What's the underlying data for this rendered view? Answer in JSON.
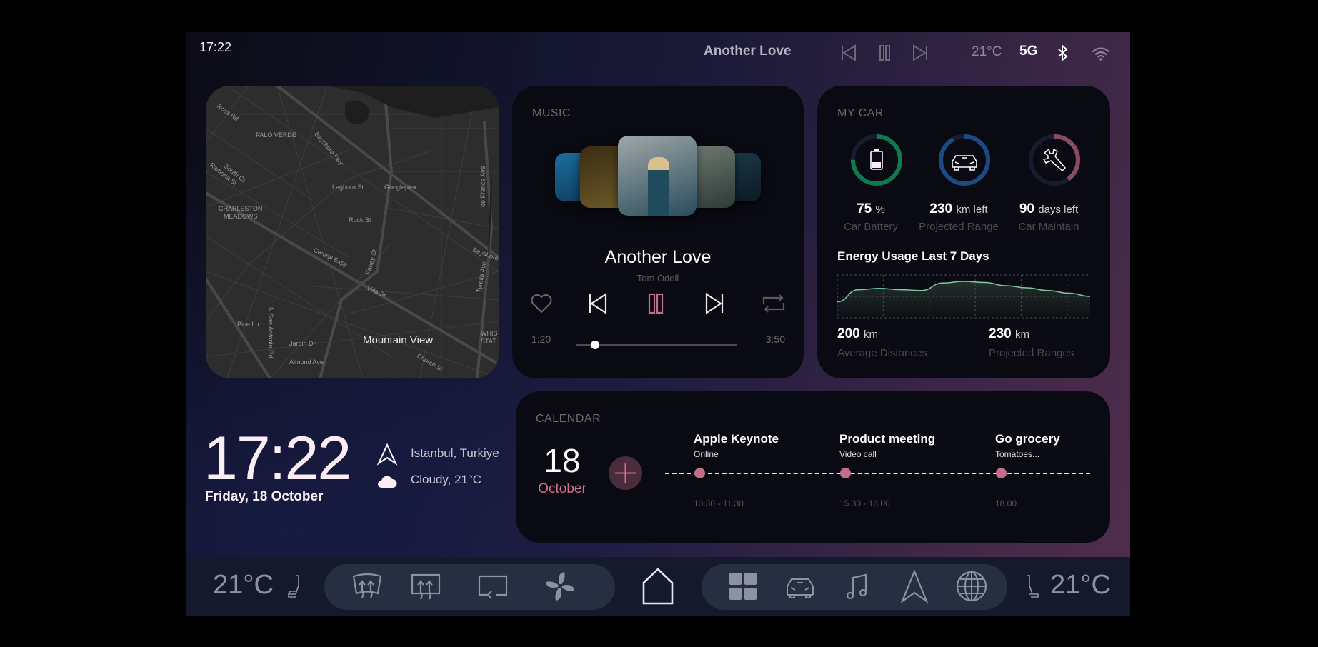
{
  "status_bar": {
    "time": "17:22",
    "now_playing": "Another Love",
    "temperature": "21°C",
    "network": "5G",
    "icons": [
      "previous-icon",
      "pause-icon",
      "next-icon",
      "bluetooth-icon",
      "wifi-icon"
    ]
  },
  "map": {
    "city_label": "Mountain View",
    "labels": [
      "Ross Rd",
      "PALO VERDE",
      "Bayshore Fwy",
      "South Ct",
      "Ramona St",
      "Leghorn St",
      "Googleplex",
      "CHARLESTON",
      "MEADOWS",
      "Rock St",
      "Central Expy",
      "Farley St",
      "Villa St",
      "de France Ave",
      "Bayshore",
      "Tyrella Ave",
      "Pine Ln",
      "N San Antonio Rd",
      "Jardin Dr",
      "Almond Ave",
      "Church St",
      "WHIS",
      "STAT"
    ]
  },
  "music": {
    "section_title": "MUSIC",
    "song_title": "Another Love",
    "artist": "Tom Odell",
    "elapsed": "1:20",
    "duration": "3:50",
    "progress_fraction": 0.12,
    "covers": [
      {
        "name": "nirvana-cover",
        "colors": [
          "#1c6fa0",
          "#0d3a5c"
        ]
      },
      {
        "name": "bmth-cover",
        "colors": [
          "#3a2c12",
          "#6e5a2a"
        ]
      },
      {
        "name": "tom-odell-cover",
        "colors": [
          "#9fa7a8",
          "#2a4d5c"
        ]
      },
      {
        "name": "caleo-cover",
        "colors": [
          "#6f7a72",
          "#2e3a36"
        ]
      },
      {
        "name": "imagine-dragons-cover",
        "colors": [
          "#1a3a4a",
          "#0c1a24"
        ]
      }
    ]
  },
  "car": {
    "section_title": "MY CAR",
    "gauges": [
      {
        "value": "75",
        "unit": "%",
        "label": "Car Battery",
        "fraction": 0.75,
        "color": "#0f7a52",
        "icon": "battery-icon"
      },
      {
        "value": "230",
        "unit": "km left",
        "label": "Projected Range",
        "fraction": 0.92,
        "color": "#1e4a82",
        "icon": "car-icon"
      },
      {
        "value": "90",
        "unit": "days left",
        "label": "Car Maintain",
        "fraction": 0.4,
        "color": "#8a4b66",
        "icon": "wrench-icon"
      }
    ],
    "energy_title": "Energy Usage Last 7 Days",
    "stats": [
      {
        "value": "200",
        "unit": "km",
        "label": "Average Distances"
      },
      {
        "value": "230",
        "unit": "km",
        "label": "Projected Ranges"
      }
    ]
  },
  "chart_data": {
    "type": "area",
    "title": "Energy Usage Last 7 Days",
    "x": [
      0,
      0.5,
      1,
      1.5,
      2,
      2.5,
      3,
      3.5,
      4,
      4.5,
      5,
      5.5,
      6
    ],
    "values": [
      0.0,
      0.45,
      0.5,
      0.45,
      0.42,
      0.7,
      0.76,
      0.72,
      0.6,
      0.52,
      0.42,
      0.32,
      0.2
    ],
    "xlabel": "",
    "ylabel": "",
    "ylim": [
      -0.6,
      1
    ],
    "grid": true,
    "color": "#7fc8a0"
  },
  "clock": {
    "time": "17:22",
    "date": "Friday, 18 October",
    "location": "Istanbul, Turkiye",
    "weather": "Cloudy, 21°C"
  },
  "calendar": {
    "section_title": "CALENDAR",
    "day": "18",
    "month": "October",
    "events": [
      {
        "title": "Apple Keynote",
        "subtitle": "Online",
        "time": "10.30 - 11.30"
      },
      {
        "title": "Product meeting",
        "subtitle": "Video call",
        "time": "15.30 - 16.00"
      },
      {
        "title": "Go grocery",
        "subtitle": "Tomatoes...",
        "time": "18.00"
      }
    ]
  },
  "dock": {
    "left_temp": "21°C",
    "right_temp": "21°C",
    "climate_icons": [
      "front-defrost-icon",
      "rear-defrost-icon",
      "air-recirculation-icon",
      "fan-icon"
    ],
    "home_icon": "home-icon",
    "app_icons": [
      "apps-grid-icon",
      "car-icon",
      "music-icon",
      "navigation-icon",
      "globe-icon"
    ]
  }
}
